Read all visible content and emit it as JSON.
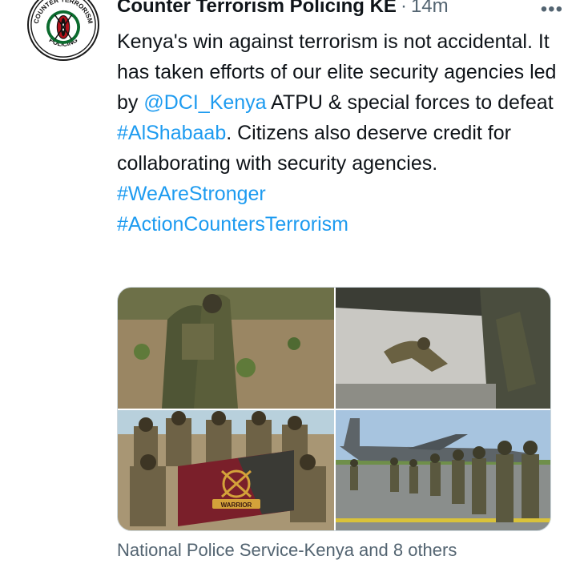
{
  "tweet": {
    "author": "Counter Terrorism Policing KE",
    "separator": "·",
    "time": "14m",
    "more_label": "•••",
    "text_segments": [
      {
        "text": "Kenya's win against terrorism is not accidental. It has taken efforts of our elite security agencies led by ",
        "link": false
      },
      {
        "text": "@DCI_Kenya",
        "link": true
      },
      {
        "text": " ATPU & special forces to defeat ",
        "link": false
      },
      {
        "text": "#AlShabaab",
        "link": true
      },
      {
        "text": ". Citizens also deserve credit for collaborating with security agencies.",
        "link": false
      }
    ],
    "hashtags": [
      "#WeAreStronger",
      "#ActionCountersTerrorism"
    ],
    "tagged_text": "National Police Service-Kenya and 8 others"
  },
  "avatar": {
    "ring_top": "COUNTER TERRORISM",
    "ring_bottom": "POLICING"
  },
  "media": {
    "banner_text": "WARRIOR"
  },
  "colors": {
    "link": "#1d9bf0",
    "muted": "#536471",
    "text": "#0f1419"
  }
}
